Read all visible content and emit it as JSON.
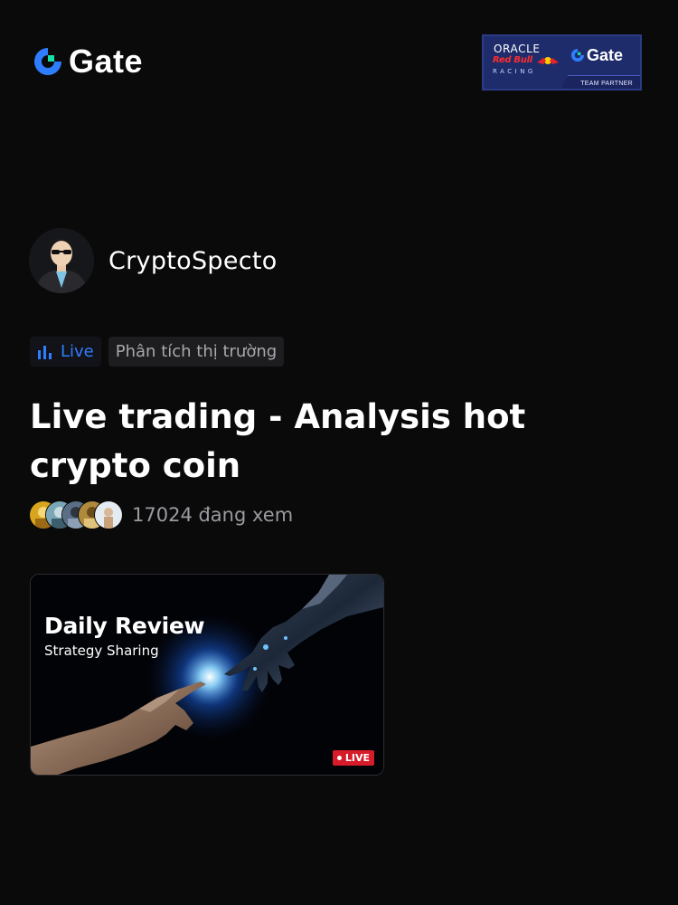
{
  "header": {
    "brand": "Gate",
    "partner_badge": {
      "oracle": "ORACLE",
      "red_bull": "Red Bull",
      "racing": "RACING",
      "brand": "Gate",
      "team_partner": "TEAM PARTNER"
    }
  },
  "profile": {
    "username": "CryptoSpecto"
  },
  "tags": {
    "live_label": "Live",
    "category": "Phân tích thị trường"
  },
  "stream": {
    "title": "Live trading - Analysis hot crypto coin",
    "viewer_count": "17024 đang xem"
  },
  "card": {
    "title": "Daily Review",
    "subtitle": "Strategy Sharing",
    "live_badge": "LIVE"
  },
  "colors": {
    "background": "#0a0a0b",
    "accent_blue": "#2f7dff",
    "live_red": "#d61b2a",
    "partner_navy": "#1e2c6b"
  }
}
